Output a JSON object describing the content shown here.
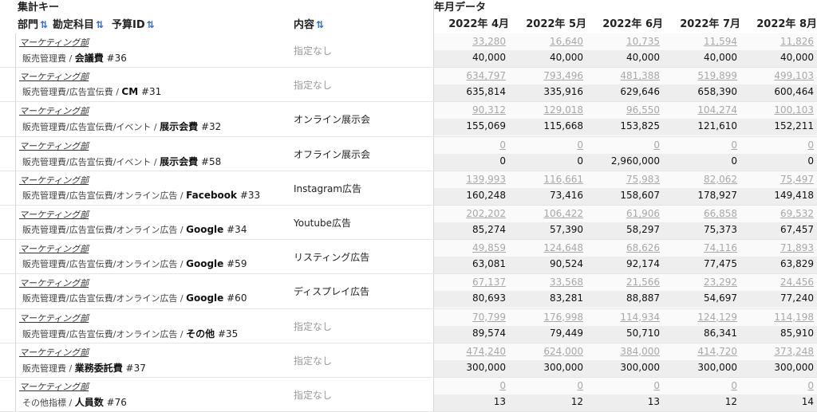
{
  "groups": {
    "keys": "集計キー",
    "months": "年月データ"
  },
  "headers": {
    "dept": "部門",
    "account": "勘定科目",
    "budget_id": "予算ID",
    "content": "内容"
  },
  "months": [
    "2022年 4月",
    "2022年 5月",
    "2022年 6月",
    "2022年 7月",
    "2022年 8月"
  ],
  "rows": [
    {
      "dept": "マーケティング部",
      "path": "販売管理費 / ",
      "leaf": "会議費",
      "id": " #36",
      "content": "指定なし",
      "muted": true,
      "actual": [
        "33,280",
        "16,640",
        "10,735",
        "11,594",
        "11,826"
      ],
      "budget": [
        "40,000",
        "40,000",
        "40,000",
        "40,000",
        "40,000"
      ]
    },
    {
      "dept": "マーケティング部",
      "path": "販売管理費/広告宣伝費 / ",
      "leaf": "CM",
      "id": " #31",
      "content": "指定なし",
      "muted": true,
      "actual": [
        "634,797",
        "793,496",
        "481,388",
        "519,899",
        "499,103"
      ],
      "budget": [
        "635,814",
        "335,916",
        "629,646",
        "658,390",
        "600,464"
      ]
    },
    {
      "dept": "マーケティング部",
      "path": "販売管理費/広告宣伝費/イベント / ",
      "leaf": "展示会費",
      "id": " #32",
      "content": "オンライン展示会",
      "muted": false,
      "actual": [
        "90,312",
        "129,018",
        "96,550",
        "104,274",
        "100,103"
      ],
      "budget": [
        "155,069",
        "115,668",
        "153,825",
        "121,610",
        "152,211"
      ]
    },
    {
      "dept": "マーケティング部",
      "path": "販売管理費/広告宣伝費/イベント / ",
      "leaf": "展示会費",
      "id": " #58",
      "content": "オフライン展示会",
      "muted": false,
      "actual": [
        "0",
        "0",
        "0",
        "0",
        "0"
      ],
      "budget": [
        "0",
        "0",
        "2,960,000",
        "0",
        "0"
      ]
    },
    {
      "dept": "マーケティング部",
      "path": "販売管理費/広告宣伝費/オンライン広告 / ",
      "leaf": "Facebook",
      "id": " #33",
      "content": "Instagram広告",
      "muted": false,
      "actual": [
        "139,993",
        "116,661",
        "75,983",
        "82,062",
        "75,497"
      ],
      "budget": [
        "160,248",
        "73,416",
        "158,607",
        "178,927",
        "149,418"
      ]
    },
    {
      "dept": "マーケティング部",
      "path": "販売管理費/広告宣伝費/オンライン広告 / ",
      "leaf": "Google",
      "id": " #34",
      "content": "Youtube広告",
      "muted": false,
      "actual": [
        "202,202",
        "106,422",
        "61,906",
        "66,858",
        "69,532"
      ],
      "budget": [
        "85,274",
        "57,390",
        "58,297",
        "75,373",
        "67,457"
      ]
    },
    {
      "dept": "マーケティング部",
      "path": "販売管理費/広告宣伝費/オンライン広告 / ",
      "leaf": "Google",
      "id": " #59",
      "content": "リスティング広告",
      "muted": false,
      "actual": [
        "49,859",
        "124,648",
        "68,626",
        "74,116",
        "71,893"
      ],
      "budget": [
        "63,081",
        "90,524",
        "92,174",
        "77,475",
        "63,829"
      ]
    },
    {
      "dept": "マーケティング部",
      "path": "販売管理費/広告宣伝費/オンライン広告 / ",
      "leaf": "Google",
      "id": " #60",
      "content": "ディスプレイ広告",
      "muted": false,
      "actual": [
        "67,137",
        "33,568",
        "21,566",
        "23,292",
        "24,456"
      ],
      "budget": [
        "80,693",
        "83,281",
        "88,887",
        "54,697",
        "77,240"
      ]
    },
    {
      "dept": "マーケティング部",
      "path": "販売管理費/広告宣伝費/オンライン広告 / ",
      "leaf": "その他",
      "id": " #35",
      "content": "指定なし",
      "muted": true,
      "actual": [
        "70,799",
        "176,998",
        "114,934",
        "124,129",
        "114,198"
      ],
      "budget": [
        "89,574",
        "79,449",
        "50,710",
        "86,341",
        "85,910"
      ]
    },
    {
      "dept": "マーケティング部",
      "path": "販売管理費 / ",
      "leaf": "業務委託費",
      "id": " #37",
      "content": "指定なし",
      "muted": true,
      "actual": [
        "474,240",
        "624,000",
        "384,000",
        "414,720",
        "373,248"
      ],
      "budget": [
        "300,000",
        "300,000",
        "300,000",
        "300,000",
        "300,000"
      ]
    },
    {
      "dept": "マーケティング部",
      "path": "その他指標 / ",
      "leaf": "人員数",
      "id": " #76",
      "content": "指定なし",
      "muted": true,
      "actual": [
        "0",
        "0",
        "0",
        "0",
        "0"
      ],
      "budget": [
        "13",
        "12",
        "13",
        "12",
        "14"
      ]
    }
  ]
}
